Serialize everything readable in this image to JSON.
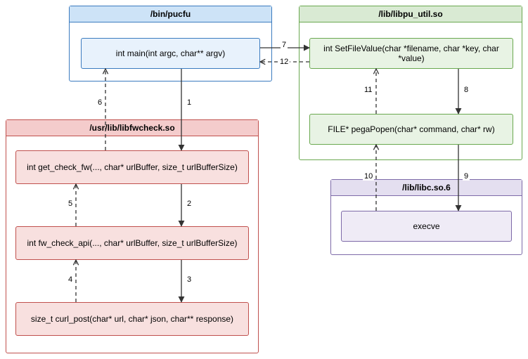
{
  "modules": {
    "blue": {
      "title": "/bin/pucfu"
    },
    "red": {
      "title": "/usr/lib/libfwcheck.so"
    },
    "green": {
      "title": "/lib/libpu_util.so"
    },
    "purple": {
      "title": "/lib/libc.so.6"
    }
  },
  "nodes": {
    "main": "int main(int argc, char** argv)",
    "get_check_fw": "int get_check_fw(..., char* urlBuffer, size_t urlBufferSize)",
    "fw_check_api": "int fw_check_api(..., char* urlBuffer, size_t urlBufferSize)",
    "curl_post": "size_t curl_post(char* url, char* json, char** response)",
    "setfilevalue": "int SetFileValue(char *filename, char *key, char *value)",
    "pegapopen": "FILE* pegaPopen(char* command, char* rw)",
    "execve": "execve"
  },
  "edges": {
    "e1": "1",
    "e2": "2",
    "e3": "3",
    "e4": "4",
    "e5": "5",
    "e6": "6",
    "e7": "7",
    "e8": "8",
    "e9": "9",
    "e10": "10",
    "e11": "11",
    "e12": "12"
  }
}
